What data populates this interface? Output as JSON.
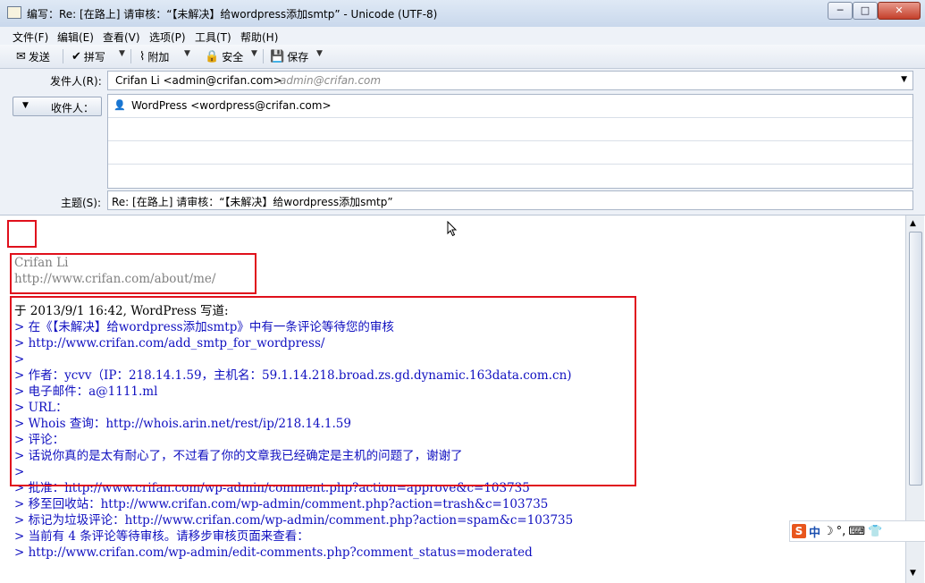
{
  "window": {
    "title": "编写：Re: [在路上] 请审核：“【未解决】给wordpress添加smtp” - Unicode (UTF-8)",
    "minimize": "─",
    "maximize": "□",
    "close": "✕"
  },
  "menu": {
    "items": [
      "文件(F)",
      "编辑(E)",
      "查看(V)",
      "选项(P)",
      "工具(T)",
      "帮助(H)"
    ]
  },
  "toolbar": {
    "send": "发送",
    "spell": "拼写",
    "attach": "附加",
    "security": "安全",
    "save": "保存"
  },
  "header": {
    "from_label": "发件人(R):",
    "from_name": "Crifan Li <admin@crifan.com>",
    "from_identity": "admin@crifan.com",
    "to_label": "收件人：",
    "to_address": "WordPress <wordpress@crifan.com>",
    "subject_label": "主题(S):",
    "subject_value": "Re: [在路上] 请审核：“【未解决】给wordpress添加smtp”"
  },
  "body": {
    "signature": [
      "Crifan Li",
      "http://www.crifan.com/about/me/"
    ],
    "quote_header": "于 2013/9/1 16:42, WordPress 写道:",
    "quoted_lines": [
      "> 在《【未解决】给wordpress添加smtp》中有一条评论等待您的审核",
      "> http://www.crifan.com/add_smtp_for_wordpress/",
      ">",
      "> 作者：ycvv（IP：218.14.1.59，主机名：59.1.14.218.broad.zs.gd.dynamic.163data.com.cn)",
      "> 电子邮件：a@1111.ml",
      "> URL：",
      "> Whois 查询：http://whois.arin.net/rest/ip/218.14.1.59",
      "> 评论：",
      "> 话说你真的是太有耐心了，不过看了你的文章我已经确定是主机的问题了，谢谢了",
      ">",
      "> 批准：http://www.crifan.com/wp-admin/comment.php?action=approve&c=103735",
      "> 移至回收站：http://www.crifan.com/wp-admin/comment.php?action=trash&c=103735",
      "> 标记为垃圾评论：http://www.crifan.com/wp-admin/comment.php?action=spam&c=103735",
      "> 当前有 4 条评论等待审核。请移步审核页面来查看：",
      "> http://www.crifan.com/wp-admin/edit-comments.php?comment_status=moderated"
    ]
  },
  "ime": {
    "logo": "S",
    "mode": "中",
    "moon": "☽",
    "punct": "°,",
    "keyboard": "⌨",
    "skin": "👕"
  }
}
